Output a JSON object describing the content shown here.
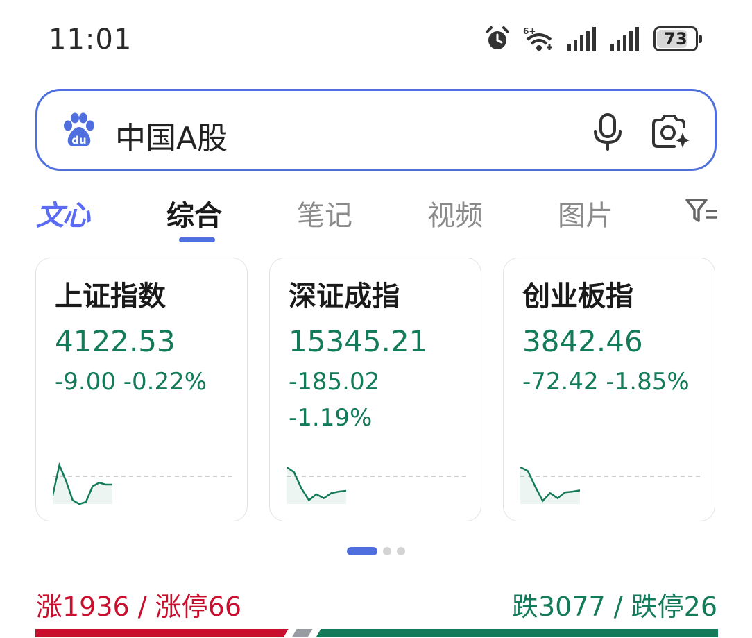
{
  "status_bar": {
    "time": "11:01",
    "battery_level": "73",
    "icons": [
      "alarm-icon",
      "wifi-6-icon",
      "signal-icon",
      "signal-icon"
    ]
  },
  "search": {
    "query": "中国A股",
    "logo": "baidu-paw-icon",
    "voice_icon": "microphone-icon",
    "image_search_icon": "camera-sparkle-icon"
  },
  "tabs": [
    {
      "label": "文心",
      "state": "brand"
    },
    {
      "label": "综合",
      "state": "active"
    },
    {
      "label": "笔记",
      "state": "inactive"
    },
    {
      "label": "视频",
      "state": "inactive"
    },
    {
      "label": "图片",
      "state": "inactive"
    }
  ],
  "filter_icon": "filter-icon",
  "indices": [
    {
      "name": "上证指数",
      "value": "4122.53",
      "change": "-9.00  -0.22%",
      "change_extra": "",
      "trend": [
        0.78,
        0.0,
        0.4,
        0.9,
        1.0,
        0.95,
        0.55,
        0.45,
        0.5,
        0.5
      ]
    },
    {
      "name": "深证成指",
      "value": "15345.21",
      "change": "-185.02",
      "change_extra": "-1.19%",
      "trend": [
        0.05,
        0.18,
        0.6,
        0.9,
        0.75,
        0.85,
        0.72,
        0.68,
        0.66
      ]
    },
    {
      "name": "创业板指",
      "value": "3842.46",
      "change": "-72.42  -1.85%",
      "change_extra": "",
      "trend": [
        0.05,
        0.15,
        0.55,
        0.92,
        0.72,
        0.85,
        0.7,
        0.68,
        0.65
      ]
    }
  ],
  "pager": {
    "pages": 3,
    "active": 0
  },
  "market_breadth": {
    "up_text": "涨1936 / 涨停66",
    "down_text": "跌3077 / 跌停26",
    "up_count": 1936,
    "flat_count": 158,
    "down_count": 3077
  },
  "colors": {
    "accent": "#4e6fdd",
    "rise": "#c8102e",
    "fall": "#137a5a",
    "flat": "#9a9ca3"
  }
}
